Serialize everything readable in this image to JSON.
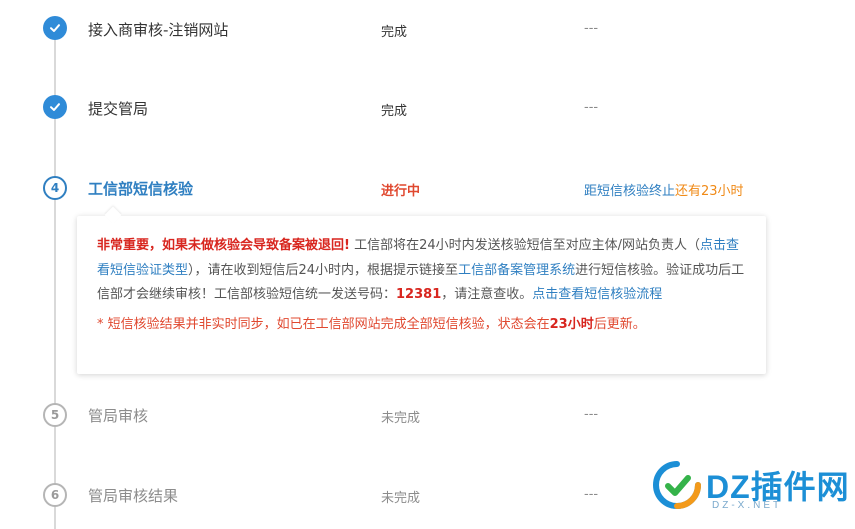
{
  "steps": [
    {
      "number": "",
      "title": "接入商审核-注销网站",
      "status": "完成",
      "note": "---",
      "state": "done"
    },
    {
      "number": "",
      "title": "提交管局",
      "status": "完成",
      "note": "---",
      "state": "done"
    },
    {
      "number": "4",
      "title": "工信部短信核验",
      "status": "进行中",
      "note_prefix": "距短信核验终止",
      "note_highlight": "还有23小时",
      "state": "active"
    },
    {
      "number": "5",
      "title": "管局审核",
      "status": "未完成",
      "note": "---",
      "state": "pending"
    },
    {
      "number": "6",
      "title": "管局审核结果",
      "status": "未完成",
      "note": "---",
      "state": "pending"
    }
  ],
  "info": {
    "warning": "非常重要，如果未做核验会导致备案被退回!",
    "text1": " 工信部将在24小时内发送核验短信至对应主体/网站负责人（",
    "link1": "点击查看短信验证类型",
    "text2": "），请在收到短信后24小时内，根据提示链接至",
    "link2": "工信部备案管理系统",
    "text3": "进行短信核验。验证成功后工信部才会继续审核！工信部核验短信统一发送号码：",
    "number": "12381",
    "text4": "，请注意查收。",
    "link3": "点击查看短信核验流程",
    "foot_prefix": "* 短信核验结果并非实时同步，如已在工信部网站完成全部短信核验，状态会在",
    "foot_bold": "23小时",
    "foot_suffix": "后更新。"
  },
  "watermark": {
    "brand": "DZ插件网",
    "url": "DZ-X.NET"
  },
  "colors": {
    "primary": "#2f7fc1",
    "done_circle": "#2f8bd8",
    "danger": "#d8261f",
    "orange": "#f08a17",
    "muted": "#8c8c8c"
  }
}
